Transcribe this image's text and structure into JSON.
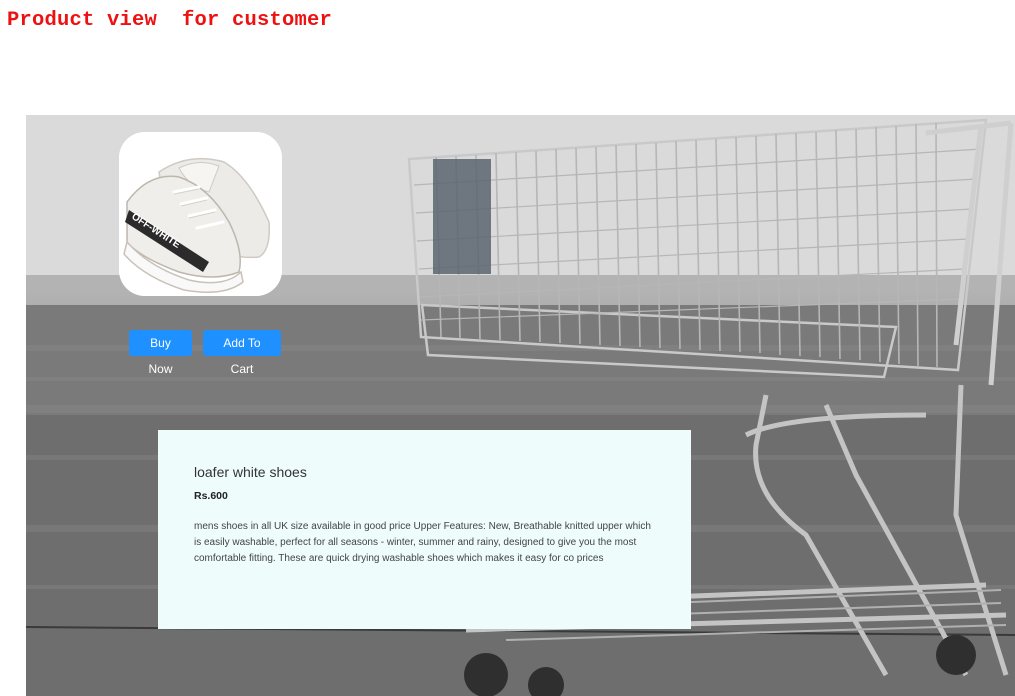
{
  "page": {
    "heading": "Product view  for customer"
  },
  "product": {
    "image": {
      "icon": "sneaker-photo",
      "logo_text": "OFF-WHITE"
    },
    "name": "loafer white shoes",
    "price": "Rs.600",
    "description": "mens shoes in all UK size available in good price Upper Features: New, Breathable knitted upper which is easily washable, perfect for all seasons - winter, summer and rainy, designed to give you the most comfortable fitting. These are quick drying washable shoes which makes it easy for co prices"
  },
  "actions": {
    "buy_now": "Buy Now",
    "add_to_cart": "Add To Cart"
  },
  "theme": {
    "heading_color": "#ee1111",
    "button_color": "#1e90ff",
    "card_color": "#eefcfc"
  }
}
